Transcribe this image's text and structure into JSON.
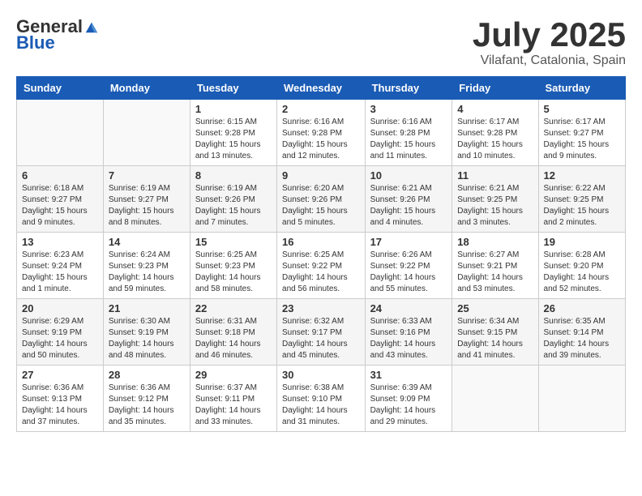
{
  "logo": {
    "text_general": "General",
    "text_blue": "Blue"
  },
  "title": {
    "month_year": "July 2025",
    "location": "Vilafant, Catalonia, Spain"
  },
  "weekdays": [
    "Sunday",
    "Monday",
    "Tuesday",
    "Wednesday",
    "Thursday",
    "Friday",
    "Saturday"
  ],
  "weeks": [
    [
      {
        "day": "",
        "sunrise": "",
        "sunset": "",
        "daylight": ""
      },
      {
        "day": "",
        "sunrise": "",
        "sunset": "",
        "daylight": ""
      },
      {
        "day": "1",
        "sunrise": "Sunrise: 6:15 AM",
        "sunset": "Sunset: 9:28 PM",
        "daylight": "Daylight: 15 hours and 13 minutes."
      },
      {
        "day": "2",
        "sunrise": "Sunrise: 6:16 AM",
        "sunset": "Sunset: 9:28 PM",
        "daylight": "Daylight: 15 hours and 12 minutes."
      },
      {
        "day": "3",
        "sunrise": "Sunrise: 6:16 AM",
        "sunset": "Sunset: 9:28 PM",
        "daylight": "Daylight: 15 hours and 11 minutes."
      },
      {
        "day": "4",
        "sunrise": "Sunrise: 6:17 AM",
        "sunset": "Sunset: 9:28 PM",
        "daylight": "Daylight: 15 hours and 10 minutes."
      },
      {
        "day": "5",
        "sunrise": "Sunrise: 6:17 AM",
        "sunset": "Sunset: 9:27 PM",
        "daylight": "Daylight: 15 hours and 9 minutes."
      }
    ],
    [
      {
        "day": "6",
        "sunrise": "Sunrise: 6:18 AM",
        "sunset": "Sunset: 9:27 PM",
        "daylight": "Daylight: 15 hours and 9 minutes."
      },
      {
        "day": "7",
        "sunrise": "Sunrise: 6:19 AM",
        "sunset": "Sunset: 9:27 PM",
        "daylight": "Daylight: 15 hours and 8 minutes."
      },
      {
        "day": "8",
        "sunrise": "Sunrise: 6:19 AM",
        "sunset": "Sunset: 9:26 PM",
        "daylight": "Daylight: 15 hours and 7 minutes."
      },
      {
        "day": "9",
        "sunrise": "Sunrise: 6:20 AM",
        "sunset": "Sunset: 9:26 PM",
        "daylight": "Daylight: 15 hours and 5 minutes."
      },
      {
        "day": "10",
        "sunrise": "Sunrise: 6:21 AM",
        "sunset": "Sunset: 9:26 PM",
        "daylight": "Daylight: 15 hours and 4 minutes."
      },
      {
        "day": "11",
        "sunrise": "Sunrise: 6:21 AM",
        "sunset": "Sunset: 9:25 PM",
        "daylight": "Daylight: 15 hours and 3 minutes."
      },
      {
        "day": "12",
        "sunrise": "Sunrise: 6:22 AM",
        "sunset": "Sunset: 9:25 PM",
        "daylight": "Daylight: 15 hours and 2 minutes."
      }
    ],
    [
      {
        "day": "13",
        "sunrise": "Sunrise: 6:23 AM",
        "sunset": "Sunset: 9:24 PM",
        "daylight": "Daylight: 15 hours and 1 minute."
      },
      {
        "day": "14",
        "sunrise": "Sunrise: 6:24 AM",
        "sunset": "Sunset: 9:23 PM",
        "daylight": "Daylight: 14 hours and 59 minutes."
      },
      {
        "day": "15",
        "sunrise": "Sunrise: 6:25 AM",
        "sunset": "Sunset: 9:23 PM",
        "daylight": "Daylight: 14 hours and 58 minutes."
      },
      {
        "day": "16",
        "sunrise": "Sunrise: 6:25 AM",
        "sunset": "Sunset: 9:22 PM",
        "daylight": "Daylight: 14 hours and 56 minutes."
      },
      {
        "day": "17",
        "sunrise": "Sunrise: 6:26 AM",
        "sunset": "Sunset: 9:22 PM",
        "daylight": "Daylight: 14 hours and 55 minutes."
      },
      {
        "day": "18",
        "sunrise": "Sunrise: 6:27 AM",
        "sunset": "Sunset: 9:21 PM",
        "daylight": "Daylight: 14 hours and 53 minutes."
      },
      {
        "day": "19",
        "sunrise": "Sunrise: 6:28 AM",
        "sunset": "Sunset: 9:20 PM",
        "daylight": "Daylight: 14 hours and 52 minutes."
      }
    ],
    [
      {
        "day": "20",
        "sunrise": "Sunrise: 6:29 AM",
        "sunset": "Sunset: 9:19 PM",
        "daylight": "Daylight: 14 hours and 50 minutes."
      },
      {
        "day": "21",
        "sunrise": "Sunrise: 6:30 AM",
        "sunset": "Sunset: 9:19 PM",
        "daylight": "Daylight: 14 hours and 48 minutes."
      },
      {
        "day": "22",
        "sunrise": "Sunrise: 6:31 AM",
        "sunset": "Sunset: 9:18 PM",
        "daylight": "Daylight: 14 hours and 46 minutes."
      },
      {
        "day": "23",
        "sunrise": "Sunrise: 6:32 AM",
        "sunset": "Sunset: 9:17 PM",
        "daylight": "Daylight: 14 hours and 45 minutes."
      },
      {
        "day": "24",
        "sunrise": "Sunrise: 6:33 AM",
        "sunset": "Sunset: 9:16 PM",
        "daylight": "Daylight: 14 hours and 43 minutes."
      },
      {
        "day": "25",
        "sunrise": "Sunrise: 6:34 AM",
        "sunset": "Sunset: 9:15 PM",
        "daylight": "Daylight: 14 hours and 41 minutes."
      },
      {
        "day": "26",
        "sunrise": "Sunrise: 6:35 AM",
        "sunset": "Sunset: 9:14 PM",
        "daylight": "Daylight: 14 hours and 39 minutes."
      }
    ],
    [
      {
        "day": "27",
        "sunrise": "Sunrise: 6:36 AM",
        "sunset": "Sunset: 9:13 PM",
        "daylight": "Daylight: 14 hours and 37 minutes."
      },
      {
        "day": "28",
        "sunrise": "Sunrise: 6:36 AM",
        "sunset": "Sunset: 9:12 PM",
        "daylight": "Daylight: 14 hours and 35 minutes."
      },
      {
        "day": "29",
        "sunrise": "Sunrise: 6:37 AM",
        "sunset": "Sunset: 9:11 PM",
        "daylight": "Daylight: 14 hours and 33 minutes."
      },
      {
        "day": "30",
        "sunrise": "Sunrise: 6:38 AM",
        "sunset": "Sunset: 9:10 PM",
        "daylight": "Daylight: 14 hours and 31 minutes."
      },
      {
        "day": "31",
        "sunrise": "Sunrise: 6:39 AM",
        "sunset": "Sunset: 9:09 PM",
        "daylight": "Daylight: 14 hours and 29 minutes."
      },
      {
        "day": "",
        "sunrise": "",
        "sunset": "",
        "daylight": ""
      },
      {
        "day": "",
        "sunrise": "",
        "sunset": "",
        "daylight": ""
      }
    ]
  ]
}
